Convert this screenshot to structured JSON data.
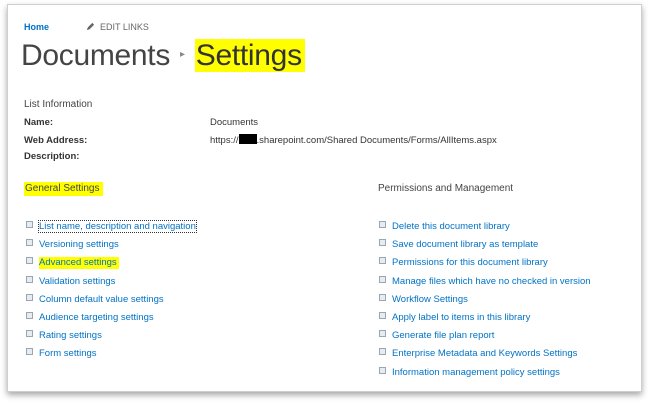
{
  "topbar": {
    "home_label": "Home",
    "edit_links_label": "EDIT LINKS",
    "edit_icon": "pencil-icon"
  },
  "title": {
    "parent": "Documents",
    "separator": "▸",
    "current": "Settings"
  },
  "list_information": {
    "heading": "List Information",
    "name_key": "Name:",
    "name_value": "Documents",
    "web_address_key": "Web Address:",
    "web_address_prefix": "https://",
    "web_address_suffix": ".sharepoint.com/Shared Documents/Forms/AllItems.aspx",
    "description_key": "Description:"
  },
  "general_settings": {
    "heading": "General Settings",
    "links": [
      "List name, description and navigation",
      "Versioning settings",
      "Advanced settings",
      "Validation settings",
      "Column default value settings",
      "Audience targeting settings",
      "Rating settings",
      "Form settings"
    ]
  },
  "permissions_management": {
    "heading": "Permissions and Management",
    "links": [
      "Delete this document library",
      "Save document library as template",
      "Permissions for this document library",
      "Manage files which have no checked in version",
      "Workflow Settings",
      "Apply label to items in this library",
      "Generate file plan report",
      "Enterprise Metadata and Keywords Settings",
      "Information management policy settings"
    ]
  },
  "colors": {
    "link": "#0072c6",
    "highlight": "#ffff00",
    "title_text": "#444444"
  }
}
